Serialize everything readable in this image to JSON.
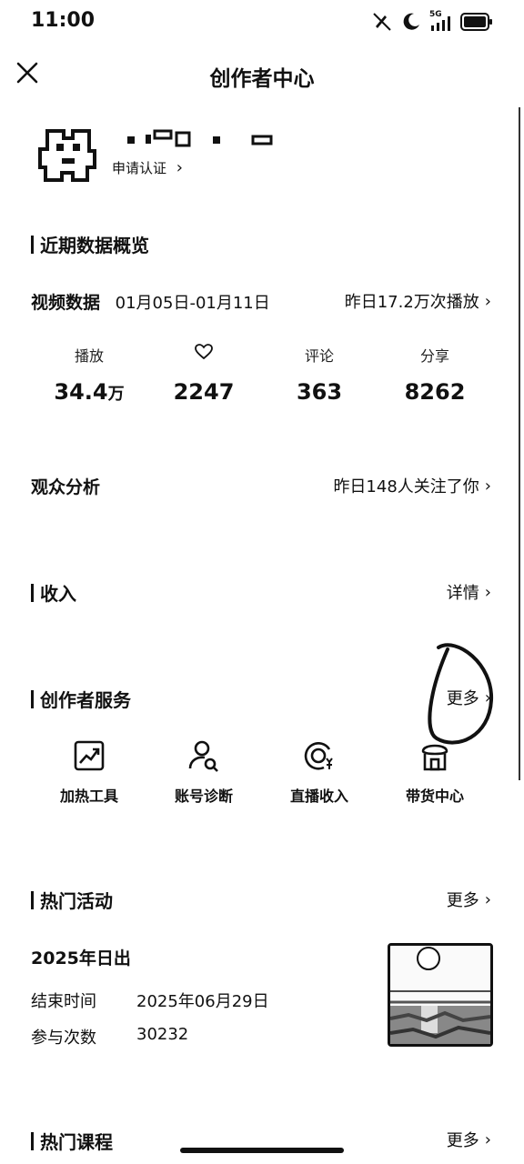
{
  "status_bar": {
    "time": "11:00",
    "network": "5G",
    "icons": [
      "mute-icon",
      "moon-icon",
      "signal-icon",
      "battery-icon"
    ]
  },
  "nav": {
    "title": "创作者中心",
    "close_icon": "close-icon"
  },
  "profile": {
    "certify_link": "申请认证"
  },
  "overview": {
    "section_title": "近期数据概览",
    "video_label": "视频数据",
    "date_range": "01月05日-01月11日",
    "yesterday_plays": "昨日17.2万次播放",
    "stats": [
      {
        "label": "播放",
        "value": "34.4",
        "unit": "万"
      },
      {
        "label": "",
        "icon": "heart-icon",
        "value": "2247"
      },
      {
        "label": "评论",
        "value": "363"
      },
      {
        "label": "分享",
        "value": "8262"
      }
    ],
    "audience_label": "观众分析",
    "audience_summary": "昨日148人关注了你"
  },
  "income": {
    "section_title": "收入",
    "details_link": "详情"
  },
  "services": {
    "section_title": "创作者服务",
    "more_link": "更多",
    "items": [
      {
        "label": "加热工具",
        "icon": "trend-chart-icon"
      },
      {
        "label": "账号诊断",
        "icon": "account-search-icon"
      },
      {
        "label": "直播收入",
        "icon": "live-income-icon"
      },
      {
        "label": "带货中心",
        "icon": "shop-icon"
      }
    ]
  },
  "activities": {
    "section_title": "热门活动",
    "more_link": "更多",
    "event_name": "2025年日出",
    "end_time_label": "结束时间",
    "end_time_value": "2025年06月29日",
    "participants_label": "参与次数",
    "participants_value": "30232"
  },
  "courses": {
    "section_title": "热门课程",
    "more_link": "更多"
  },
  "colors": {
    "text": "#111111",
    "background": "#ffffff"
  }
}
